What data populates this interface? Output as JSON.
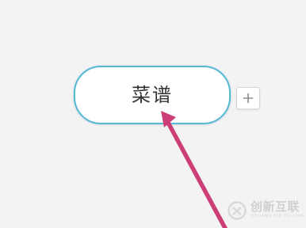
{
  "mindmap": {
    "topic": {
      "label": "菜谱"
    },
    "add_button": {
      "icon": "plus-icon"
    }
  },
  "annotation": {
    "arrow_color": "#cc3f76",
    "arrow_target": "topic-node"
  },
  "watermark": {
    "title": "创新互联",
    "subtitle": "CHUANG XIN HU LIAN"
  }
}
